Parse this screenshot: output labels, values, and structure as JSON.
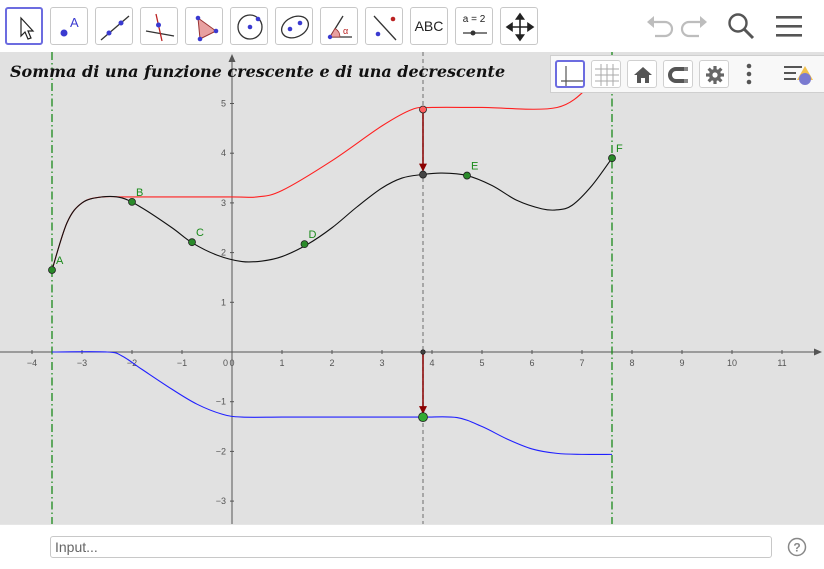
{
  "toolbar": {
    "tools": [
      {
        "name": "move-tool",
        "icon": "arrow-cursor-icon",
        "selected": true
      },
      {
        "name": "point-tool",
        "icon": "point-icon",
        "label": "A"
      },
      {
        "name": "line-tool",
        "icon": "line-through-two-points-icon"
      },
      {
        "name": "perpendicular-line-tool",
        "icon": "perpendicular-line-icon"
      },
      {
        "name": "polygon-tool",
        "icon": "polygon-icon"
      },
      {
        "name": "circle-tool",
        "icon": "circle-center-point-icon"
      },
      {
        "name": "ellipse-tool",
        "icon": "ellipse-icon"
      },
      {
        "name": "angle-tool",
        "icon": "angle-icon",
        "label": "α"
      },
      {
        "name": "reflect-tool",
        "icon": "reflect-about-line-icon"
      },
      {
        "name": "text-tool",
        "icon": "text-icon",
        "label": "ABC"
      },
      {
        "name": "slider-tool",
        "icon": "slider-icon",
        "label": "a = 2"
      },
      {
        "name": "move-graphics-view-tool",
        "icon": "move-arrows-icon"
      }
    ],
    "right_icons": [
      "undo-icon",
      "redo-icon",
      "search-icon",
      "menu-icon"
    ]
  },
  "style_bar": {
    "buttons": [
      "show-axes-icon",
      "show-grid-icon",
      "home-icon",
      "snap-magnet-icon",
      "settings-gear-icon",
      "more-vertical-icon",
      "toggle-style-bar-icon"
    ]
  },
  "title": "Somma di una funzione crescente e di una decrescente",
  "input_bar": {
    "placeholder": "Input...",
    "value": "",
    "help_icon": "help-icon"
  },
  "colors": {
    "background": "#e1e1e1",
    "red_curve": "#ff2020",
    "black_curve": "#111111",
    "blue_curve": "#2020ff",
    "points": "#1a8a1a",
    "vectors": "#8b0000",
    "selection": "#6c6ce0"
  },
  "chart_data": {
    "type": "line",
    "x_ticks": [
      -4,
      -3,
      -2,
      -1,
      0,
      1,
      2,
      3,
      4,
      5,
      6,
      7,
      8,
      9,
      10,
      11
    ],
    "y_ticks": [
      -3,
      -2,
      -1,
      1,
      2,
      3,
      4,
      5
    ],
    "xlim": [
      -4.6,
      12.6
    ],
    "ylim": [
      -3.5,
      6.0
    ],
    "origin_label": "0",
    "grid": false,
    "series": [
      {
        "color": "red",
        "points": [
          [
            -3.6,
            1.65
          ],
          [
            -3.3,
            2.6
          ],
          [
            -3.0,
            3.0
          ],
          [
            -2.6,
            3.12
          ],
          [
            -2.0,
            3.12
          ],
          [
            0.0,
            3.12
          ],
          [
            0.5,
            3.12
          ],
          [
            1.0,
            3.25
          ],
          [
            2.0,
            3.85
          ],
          [
            3.0,
            4.55
          ],
          [
            3.6,
            4.88
          ],
          [
            4.0,
            4.92
          ],
          [
            5.0,
            4.92
          ],
          [
            6.5,
            4.92
          ],
          [
            7.2,
            5.4
          ]
        ]
      },
      {
        "color": "black",
        "points": [
          [
            -3.6,
            1.65
          ],
          [
            -3.3,
            2.6
          ],
          [
            -3.0,
            3.0
          ],
          [
            -2.6,
            3.12
          ],
          [
            -2.2,
            3.1
          ],
          [
            -1.8,
            2.9
          ],
          [
            -1.2,
            2.5
          ],
          [
            -0.8,
            2.2
          ],
          [
            -0.3,
            1.95
          ],
          [
            0.2,
            1.82
          ],
          [
            0.6,
            1.83
          ],
          [
            1.0,
            1.92
          ],
          [
            1.5,
            2.16
          ],
          [
            2.0,
            2.5
          ],
          [
            2.5,
            2.92
          ],
          [
            3.0,
            3.3
          ],
          [
            3.4,
            3.5
          ],
          [
            3.8,
            3.57
          ],
          [
            4.2,
            3.6
          ],
          [
            4.7,
            3.55
          ],
          [
            5.2,
            3.35
          ],
          [
            5.7,
            3.05
          ],
          [
            6.2,
            2.88
          ],
          [
            6.5,
            2.86
          ],
          [
            6.8,
            2.95
          ],
          [
            7.2,
            3.35
          ],
          [
            7.6,
            3.9
          ]
        ]
      },
      {
        "color": "blue",
        "points": [
          [
            -3.6,
            0.0
          ],
          [
            -2.5,
            0.0
          ],
          [
            -2.2,
            -0.08
          ],
          [
            -1.8,
            -0.35
          ],
          [
            -1.2,
            -0.75
          ],
          [
            -0.7,
            -1.05
          ],
          [
            -0.2,
            -1.25
          ],
          [
            0.2,
            -1.31
          ],
          [
            1.0,
            -1.31
          ],
          [
            2.0,
            -1.31
          ],
          [
            3.0,
            -1.31
          ],
          [
            3.82,
            -1.31
          ],
          [
            4.5,
            -1.32
          ],
          [
            5.0,
            -1.5
          ],
          [
            5.5,
            -1.75
          ],
          [
            6.0,
            -1.95
          ],
          [
            6.5,
            -2.04
          ],
          [
            7.0,
            -2.06
          ],
          [
            7.6,
            -2.06
          ]
        ]
      }
    ],
    "points": [
      {
        "label": "A",
        "x": -3.6,
        "y": 1.65
      },
      {
        "label": "B",
        "x": -2.0,
        "y": 3.02
      },
      {
        "label": "C",
        "x": -0.8,
        "y": 2.21
      },
      {
        "label": "D",
        "x": 1.45,
        "y": 2.17
      },
      {
        "label": "E",
        "x": 4.7,
        "y": 3.55
      },
      {
        "label": "F",
        "x": 7.6,
        "y": 3.9
      }
    ],
    "unlabeled_points": [
      {
        "x": 3.82,
        "y": 4.88,
        "color": "red"
      },
      {
        "x": 3.82,
        "y": 3.57,
        "color": "black"
      },
      {
        "x": 3.82,
        "y": 0.0,
        "color": "black"
      },
      {
        "x": 3.82,
        "y": -1.31,
        "color": "green"
      }
    ],
    "vectors": [
      {
        "from": [
          3.82,
          4.88
        ],
        "to": [
          3.82,
          3.57
        ]
      },
      {
        "from": [
          3.82,
          0.0
        ],
        "to": [
          3.82,
          -1.31
        ]
      }
    ],
    "vertical_lines": [
      {
        "x": -3.6,
        "style": "dash-dot",
        "color": "green"
      },
      {
        "x": 3.82,
        "style": "dashed",
        "color": "gray"
      },
      {
        "x": 7.6,
        "style": "dash-dot",
        "color": "green"
      }
    ]
  }
}
